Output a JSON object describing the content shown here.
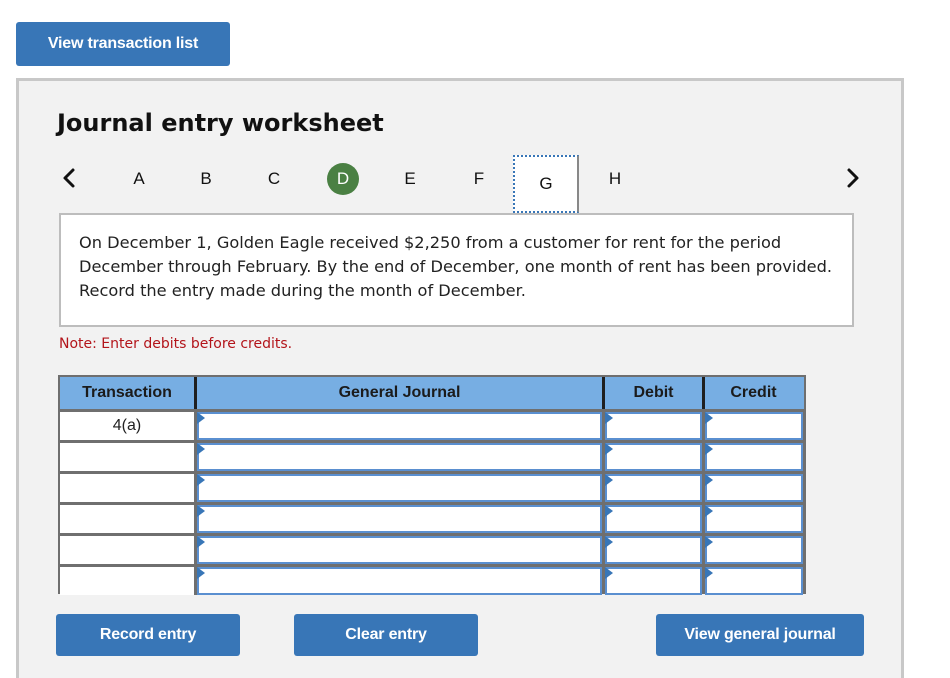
{
  "top_button": {
    "label": "View transaction list"
  },
  "worksheet": {
    "title": "Journal entry worksheet",
    "nav": {
      "prev_icon": "chevron-left-icon",
      "next_icon": "chevron-right-icon",
      "tabs": [
        {
          "label": "A",
          "state": "default"
        },
        {
          "label": "B",
          "state": "default"
        },
        {
          "label": "C",
          "state": "default"
        },
        {
          "label": "D",
          "state": "active"
        },
        {
          "label": "E",
          "state": "default"
        },
        {
          "label": "F",
          "state": "default"
        },
        {
          "label": "G",
          "state": "focused"
        },
        {
          "label": "H",
          "state": "default"
        }
      ]
    },
    "description": "On December 1, Golden Eagle received $2,250 from a customer for rent for the period December through February. By the end of December, one month of rent has been provided. Record the entry made during the month of December.",
    "note": "Note: Enter debits before credits."
  },
  "journal": {
    "headers": {
      "transaction": "Transaction",
      "general_journal": "General Journal",
      "debit": "Debit",
      "credit": "Credit"
    },
    "rows": [
      {
        "transaction": "4(a)",
        "account": "",
        "debit": "",
        "credit": ""
      },
      {
        "transaction": "",
        "account": "",
        "debit": "",
        "credit": ""
      },
      {
        "transaction": "",
        "account": "",
        "debit": "",
        "credit": ""
      },
      {
        "transaction": "",
        "account": "",
        "debit": "",
        "credit": ""
      },
      {
        "transaction": "",
        "account": "",
        "debit": "",
        "credit": ""
      },
      {
        "transaction": "",
        "account": "",
        "debit": "",
        "credit": ""
      }
    ]
  },
  "buttons": {
    "record": "Record entry",
    "clear": "Clear entry",
    "view_general_journal": "View general journal"
  },
  "colors": {
    "button_blue": "#3876b7",
    "header_blue": "#77aee3",
    "active_tab_green": "#4a8043",
    "note_red": "#b3141a",
    "panel_bg": "#f2f2f2"
  }
}
